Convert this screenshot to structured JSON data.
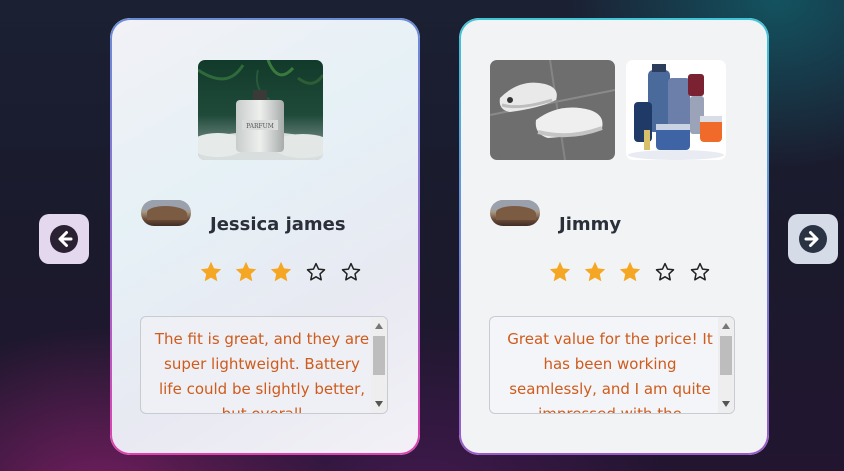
{
  "nav": {
    "prev_icon": "arrow-left-circle-icon",
    "next_icon": "arrow-right-circle-icon"
  },
  "cards": [
    {
      "images": [
        "perfume-bottle-photo"
      ],
      "reviewer_name": "Jessica james",
      "rating": 3,
      "max_rating": 5,
      "review": "The fit is great, and they are super lightweight. Battery life could be slightly better, but overall"
    },
    {
      "images": [
        "sneakers-photo",
        "cosmetics-bottles-photo"
      ],
      "reviewer_name": "Jimmy",
      "rating": 3,
      "max_rating": 5,
      "review": "Great value for the price! It has been working seamlessly, and I am quite impressed with the"
    }
  ],
  "colors": {
    "star_filled": "#f5a623",
    "review_text": "#cf5b1c",
    "name_text": "#2a2f3a"
  }
}
